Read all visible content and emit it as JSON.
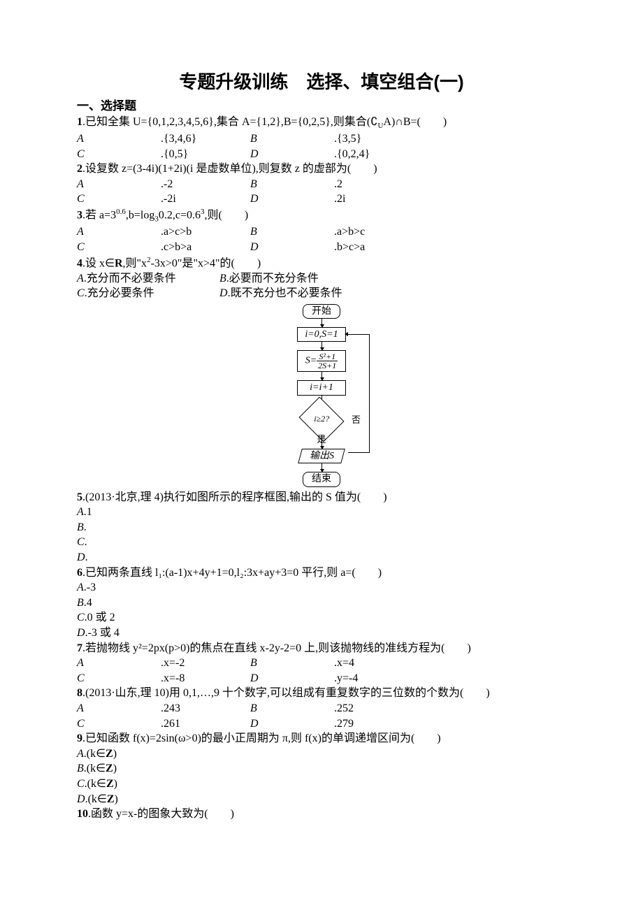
{
  "title": "专题升级训练　选择、填空组合(一)",
  "section1": "一、选择题",
  "q1": {
    "stem": "已知全集 U={0,1,2,3,4,5,6},集合 A={1,2},B={0,2,5},则集合(∁",
    "stem_sub": "U",
    "stem2": "A)∩B=(　　)",
    "A": "{3,4,6}",
    "B": "{3,5}",
    "C": "{0,5}",
    "D": "{0,2,4}"
  },
  "q2": {
    "stem": "设复数 z=(3-4i)(1+2i)(i 是虚数单位),则复数 z 的虚部为(　　)",
    "A": "-2",
    "B": "2",
    "C": "-2i",
    "D": "2i"
  },
  "q3": {
    "stem_a": "若 a=3",
    "sup1": "0.6",
    "stem_b": ",b=log",
    "sub1": "3",
    "stem_c": "0.2,c=0.6",
    "sup2": "3",
    "stem_d": ",则(　　)",
    "A": "a>c>b",
    "B": "a>b>c",
    "C": "c>b>a",
    "D": "b>c>a"
  },
  "q4": {
    "stem_a": "设 x∈",
    "R": "R",
    "stem_b": ",则\"x",
    "sup": "2",
    "stem_c": "-3x>0\"是\"x>4\"的(　　)",
    "A": "充分而不必要条件",
    "B": "必要而不充分条件",
    "C": "充分必要条件",
    "D": "既不充分也不必要条件"
  },
  "flow": {
    "start": "开始",
    "init": "i=0,S=1",
    "calc_num": "S²+1",
    "calc_den": "2S+1",
    "calc_lhs": "S=",
    "inc": "i=i+1",
    "cond": "i≥2?",
    "no": "否",
    "yes": "是",
    "out": "输出S",
    "end": "结束"
  },
  "q5": {
    "stem": "(2013·北京,理 4)执行如图所示的程序框图,输出的 S 值为(　　)",
    "A": "1",
    "B": "",
    "C": "",
    "D": ""
  },
  "q6": {
    "stem": "已知两条直线 l₁:(a-1)x+4y+1=0,l₂:3x+ay+3=0 平行,则 a=(　　)",
    "A": "-3",
    "B": "4",
    "C": "0 或 2",
    "D": "-3 或 4"
  },
  "q7": {
    "stem": "若抛物线 y²=2px(p>0)的焦点在直线 x-2y-2=0 上,则该抛物线的准线方程为(　　)",
    "A": "x=-2",
    "B": "x=4",
    "C": "x=-8",
    "D": "y=-4"
  },
  "q8": {
    "stem": "(2013·山东,理 10)用 0,1,…,9 十个数字,可以组成有重复数字的三位数的个数为(　　)",
    "A": "243",
    "B": "252",
    "C": "261",
    "D": "279"
  },
  "q9": {
    "stem": "已知函数 f(x)=2sin(ω>0)的最小正周期为 π,则 f(x)的单调递增区间为(　　)",
    "A_a": "(k∈",
    "Z": "Z",
    "A_b": ")"
  },
  "q10": {
    "stem": "函数 y=x-的图象大致为(　　)"
  }
}
